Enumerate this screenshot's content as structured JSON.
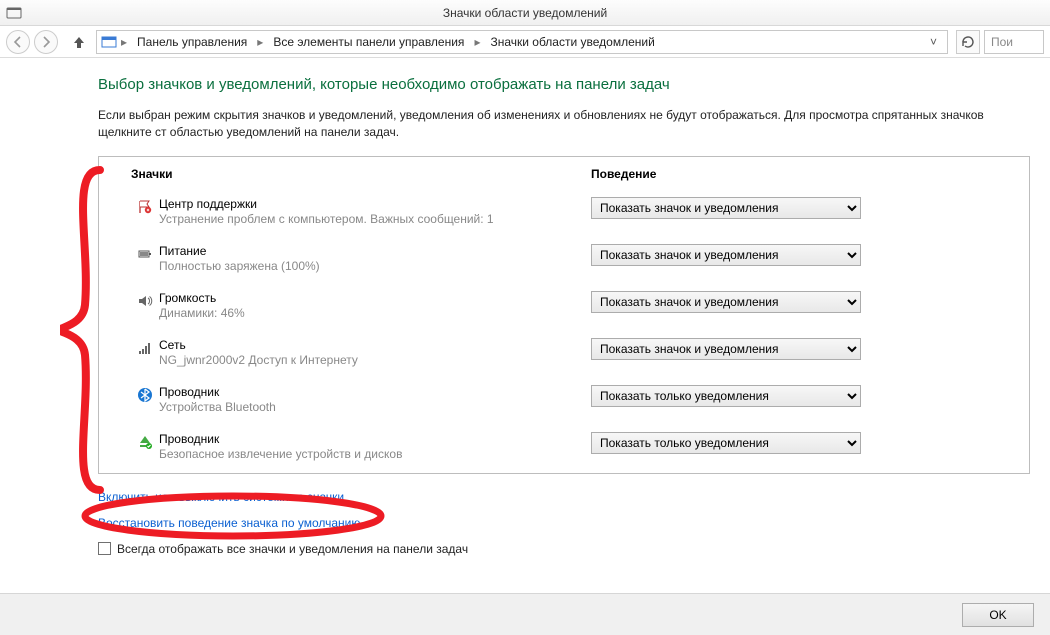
{
  "window": {
    "title": "Значки области уведомлений"
  },
  "nav": {
    "crumbs": [
      "Панель управления",
      "Все элементы панели управления",
      "Значки области уведомлений"
    ],
    "search_placeholder": "Пои"
  },
  "page": {
    "title": "Выбор значков и уведомлений, которые необходимо отображать на панели задач",
    "description": "Если выбран режим скрытия значков и уведомлений, уведомления об изменениях и обновлениях не будут отображаться. Для просмотра спрятанных значков щелкните ст областью уведомлений на панели задач."
  },
  "headers": {
    "icons": "Значки",
    "behavior": "Поведение"
  },
  "options": {
    "show_icon_and_notif": "Показать значок и уведомления",
    "show_only_notif": "Показать только уведомления"
  },
  "items": [
    {
      "icon": "flag",
      "title": "Центр поддержки",
      "sub": "Устранение проблем с компьютером. Важных сообщений: 1",
      "selected": "show_icon_and_notif"
    },
    {
      "icon": "battery",
      "title": "Питание",
      "sub": "Полностью заряжена (100%)",
      "selected": "show_icon_and_notif"
    },
    {
      "icon": "volume",
      "title": "Громкость",
      "sub": "Динамики: 46%",
      "selected": "show_icon_and_notif"
    },
    {
      "icon": "network",
      "title": "Сеть",
      "sub": "NG_jwnr2000v2 Доступ к Интернету",
      "selected": "show_icon_and_notif"
    },
    {
      "icon": "bluetooth",
      "title": "Проводник",
      "sub": "Устройства Bluetooth",
      "selected": "show_only_notif"
    },
    {
      "icon": "eject",
      "title": "Проводник",
      "sub": "Безопасное извлечение устройств и дисков",
      "selected": "show_only_notif"
    }
  ],
  "links": {
    "system_icons": "Включить или выключить системные значки",
    "restore": "Восстановить поведение значка по умолчанию"
  },
  "checkbox": {
    "label": "Всегда отображать все значки и уведомления на панели задач"
  },
  "footer": {
    "ok": "OK"
  }
}
